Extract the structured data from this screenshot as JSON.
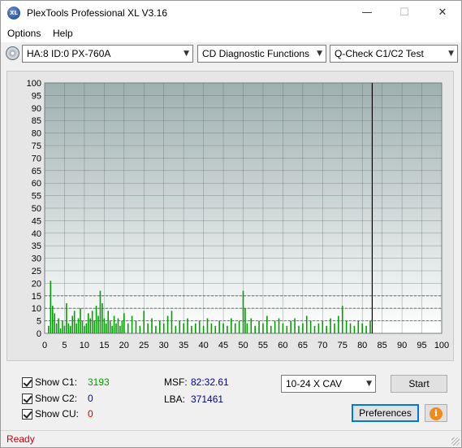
{
  "window": {
    "title": "PlexTools Professional XL V3.16",
    "icon_text": "XL",
    "minimize_glyph": "—",
    "maximize_glyph": "☐",
    "close_glyph": "✕"
  },
  "menu": {
    "items": [
      {
        "label": "Options"
      },
      {
        "label": "Help"
      }
    ]
  },
  "toolbar": {
    "drive_select": "HA:8 ID:0  PX-760A",
    "function_select": "CD Diagnostic Functions",
    "test_select": "Q-Check C1/C2 Test",
    "dropdown_glyph": "▼"
  },
  "chart_data": {
    "type": "bar",
    "x_label": "",
    "y_label": "",
    "xlim": [
      0,
      100
    ],
    "ylim": [
      0,
      100
    ],
    "x_ticks": [
      0,
      5,
      10,
      15,
      20,
      25,
      30,
      35,
      40,
      45,
      50,
      55,
      60,
      65,
      70,
      75,
      80,
      85,
      90,
      95,
      100
    ],
    "y_ticks": [
      0,
      5,
      10,
      15,
      20,
      25,
      30,
      35,
      40,
      45,
      50,
      55,
      60,
      65,
      70,
      75,
      80,
      85,
      90,
      95,
      100
    ],
    "disc_end_x": 82.5,
    "dashed_levels": [
      5,
      10,
      15
    ],
    "grid": true,
    "colors": {
      "plot_bg_top": "#9fb0b0",
      "plot_bg_bottom": "#ffffff",
      "grid": "#4d6060",
      "c1": "#00a000",
      "marker": "#000000"
    },
    "series": [
      {
        "name": "C1",
        "x": [
          1,
          1.5,
          2,
          2.5,
          3,
          3.5,
          4,
          4.5,
          5,
          5.5,
          6,
          6.5,
          7,
          7.5,
          8,
          8.5,
          9,
          9.5,
          10,
          10.5,
          11,
          11.5,
          12,
          12.5,
          13,
          13.5,
          14,
          14.5,
          15,
          15.5,
          16,
          16.5,
          17,
          17.5,
          18,
          18.5,
          19,
          19.5,
          20,
          21,
          22,
          23,
          24,
          25,
          26,
          27,
          28,
          29,
          30,
          31,
          32,
          33,
          34,
          35,
          36,
          37,
          38,
          39,
          40,
          41,
          42,
          43,
          44,
          45,
          46,
          47,
          48,
          49,
          50,
          50.5,
          51,
          52,
          53,
          54,
          55,
          56,
          57,
          58,
          59,
          60,
          61,
          62,
          63,
          64,
          65,
          66,
          67,
          68,
          69,
          70,
          71,
          72,
          73,
          74,
          75,
          76,
          77,
          78,
          79,
          80,
          81,
          82
        ],
        "values": [
          3,
          21,
          11,
          8,
          4,
          6,
          2,
          5,
          3,
          12,
          4,
          3,
          7,
          9,
          4,
          6,
          10,
          5,
          3,
          4,
          8,
          6,
          9,
          5,
          11,
          7,
          17,
          12,
          6,
          4,
          9,
          5,
          3,
          7,
          4,
          6,
          3,
          5,
          8,
          4,
          7,
          5,
          3,
          9,
          4,
          6,
          3,
          5,
          4,
          7,
          9,
          3,
          5,
          4,
          6,
          3,
          4,
          5,
          3,
          6,
          4,
          3,
          5,
          4,
          3,
          6,
          4,
          5,
          17,
          10,
          4,
          6,
          3,
          5,
          4,
          7,
          3,
          5,
          6,
          4,
          3,
          5,
          6,
          3,
          4,
          7,
          5,
          3,
          4,
          5,
          3,
          6,
          4,
          7,
          11,
          5,
          4,
          3,
          5,
          4,
          3,
          5
        ]
      }
    ]
  },
  "controls": {
    "show_c1_label": "Show C1:",
    "show_c1_value": "3193",
    "show_c2_label": "Show C2:",
    "show_c2_value": "0",
    "show_cu_label": "Show CU:",
    "show_cu_value": "0",
    "msf_label": "MSF:",
    "msf_value": "82:32.61",
    "lba_label": "LBA:",
    "lba_value": "371461",
    "speed_select": "10-24 X CAV",
    "start_label": "Start",
    "preferences_label": "Preferences",
    "info_glyph": "i",
    "colors": {
      "c1_value": "#00a000",
      "c2_value": "#0000c0",
      "cu_value": "#d00000"
    }
  },
  "status": {
    "text": "Ready"
  }
}
